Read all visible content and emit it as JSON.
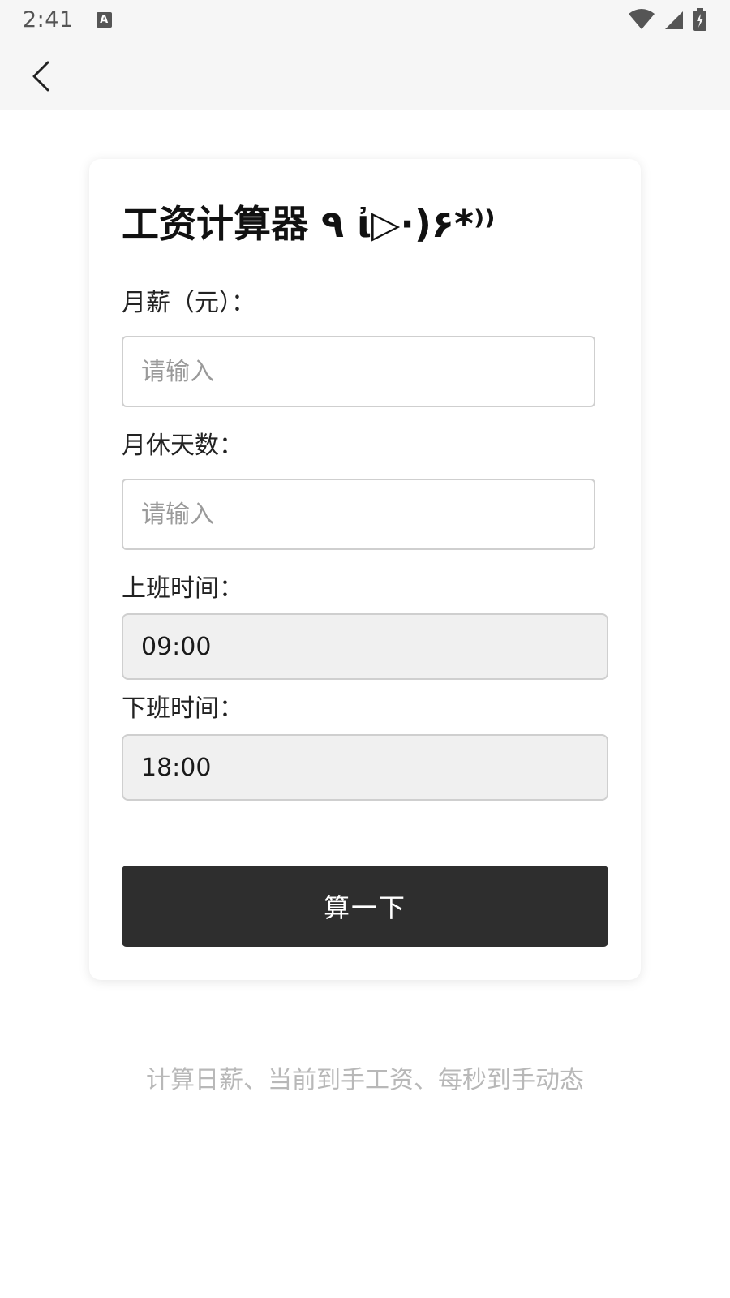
{
  "status_bar": {
    "time": "2:41",
    "notification_icon": "a-keyboard-icon",
    "icons": [
      "wifi-icon",
      "signal-icon",
      "battery-charging-icon"
    ]
  },
  "nav": {
    "back_icon": "chevron-left-icon"
  },
  "form": {
    "title": "工资计算器 ٩ ἰ▷·)۶*⁾⁾",
    "salary": {
      "label": "月薪（元）：",
      "placeholder": "请输入",
      "value": ""
    },
    "rest_days": {
      "label": "月休天数：",
      "placeholder": "请输入",
      "value": ""
    },
    "start_time": {
      "label": "上班时间：",
      "value": "09:00"
    },
    "end_time": {
      "label": "下班时间：",
      "value": "18:00"
    },
    "submit_label": "算一下"
  },
  "footer": {
    "description": "计算日薪、当前到手工资、每秒到手动态"
  },
  "colors": {
    "button_bg": "#2e2e2e",
    "time_field_bg": "#f0f0f0",
    "footer_text": "#b8b8b8",
    "bar_bg": "#f6f6f6"
  }
}
